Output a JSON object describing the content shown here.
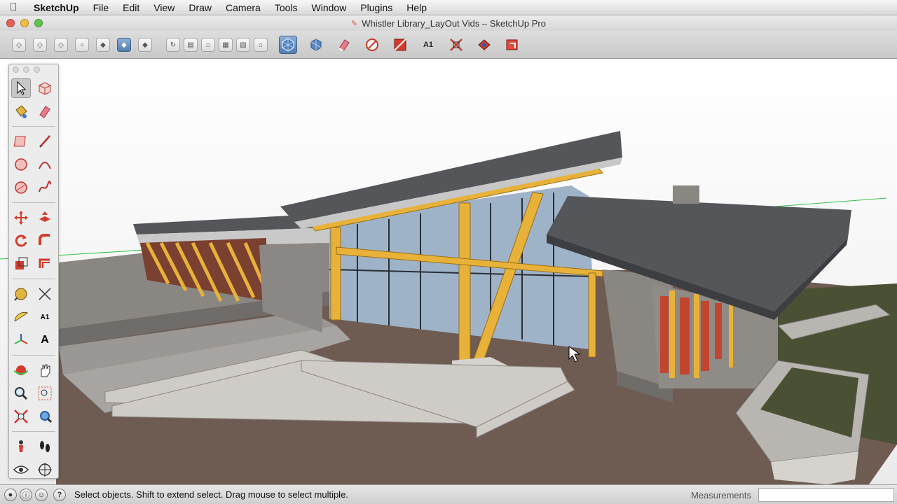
{
  "menubar": {
    "apple": "",
    "items": [
      "SketchUp",
      "File",
      "Edit",
      "View",
      "Draw",
      "Camera",
      "Tools",
      "Window",
      "Plugins",
      "Help"
    ]
  },
  "window": {
    "title": "Whistler Library_LayOut Vids – SketchUp Pro"
  },
  "toolbar": {
    "view_buttons": [
      "iso-view-icon",
      "top-view-icon",
      "front-view-icon",
      "right-view-icon",
      "back-view-icon",
      "left-view-icon",
      "bottom-view-icon"
    ],
    "style_buttons": [
      "xray-icon",
      "wireframe-icon",
      "hidden-line-icon",
      "shaded-icon",
      "shaded-textures-icon",
      "monochrome-icon"
    ],
    "extra_buttons": [
      "get-models-icon",
      "share-model-icon",
      "eraser-icon",
      "compass-icon",
      "section-plane-icon",
      "text-icon",
      "zoom-extents-icon",
      "layout-icon",
      "send-to-layout-icon"
    ],
    "text_tool_label": "A1"
  },
  "palette": {
    "text_tool_label": "A1",
    "dimension_tool_label": "A"
  },
  "status": {
    "message": "Select objects. Shift to extend select. Drag mouse to select multiple.",
    "help": "?",
    "measurements_label": "Measurements",
    "measurements_value": ""
  },
  "colors": {
    "roof": "#55565a",
    "timber": "#e8b23a",
    "stone": "#8a8682",
    "glass": "#9fb3c8",
    "ground": "#6e5b52",
    "selection": "#4f7db0"
  }
}
